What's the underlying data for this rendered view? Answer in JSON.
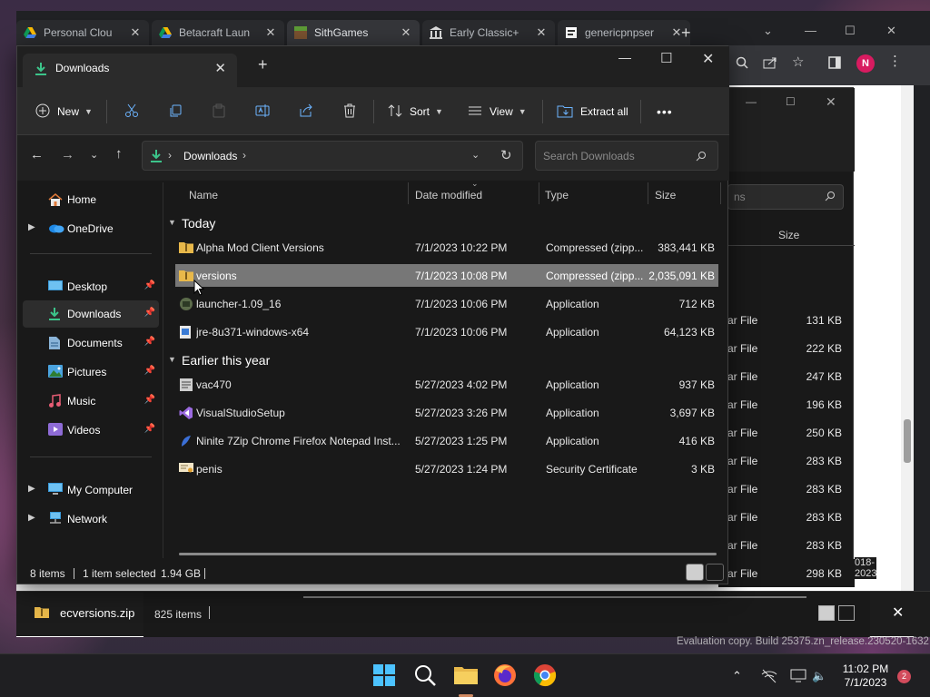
{
  "browser": {
    "tabs": [
      {
        "title": "Personal Clou",
        "icon": "google-drive-icon"
      },
      {
        "title": "Betacraft Laun",
        "icon": "google-drive-icon"
      },
      {
        "title": "SithGames",
        "icon": "minecraft-block-icon"
      },
      {
        "title": "Early Classic+",
        "icon": "bank-icon"
      },
      {
        "title": "genericpnpser",
        "icon": "page-icon"
      }
    ],
    "new_tab": "+",
    "profile_initial": "N"
  },
  "explorer2": {
    "search_placeholder": "ns",
    "size_header": "Size",
    "rows": [
      {
        "type": "ar File",
        "size": "131 KB"
      },
      {
        "type": "ar File",
        "size": "222 KB"
      },
      {
        "type": "ar File",
        "size": "247 KB"
      },
      {
        "type": "ar File",
        "size": "196 KB"
      },
      {
        "type": "ar File",
        "size": "250 KB"
      },
      {
        "type": "ar File",
        "size": "283 KB"
      },
      {
        "type": "ar File",
        "size": "283 KB"
      },
      {
        "type": "ar File",
        "size": "283 KB"
      },
      {
        "type": "ar File",
        "size": "283 KB"
      },
      {
        "type": "ar File",
        "size": "298 KB"
      }
    ],
    "date_fragment": "018-2023",
    "items_count": "825 items",
    "selected_file": "ecversions.zip"
  },
  "explorer": {
    "tab_title": "Downloads",
    "toolbar": {
      "new": "New",
      "sort": "Sort",
      "view": "View",
      "extract_all": "Extract all",
      "more": "•••"
    },
    "address": "Downloads",
    "search_placeholder": "Search Downloads",
    "sidebar": [
      {
        "label": "Home",
        "icon": "home-icon",
        "pinned": false,
        "expandable": false
      },
      {
        "label": "OneDrive",
        "icon": "onedrive-icon",
        "pinned": false,
        "expandable": true
      },
      {
        "label": "Desktop",
        "icon": "desktop-icon",
        "pinned": true,
        "expandable": false
      },
      {
        "label": "Downloads",
        "icon": "downloads-icon",
        "pinned": true,
        "expandable": false,
        "selected": true
      },
      {
        "label": "Documents",
        "icon": "documents-icon",
        "pinned": true,
        "expandable": false
      },
      {
        "label": "Pictures",
        "icon": "pictures-icon",
        "pinned": true,
        "expandable": false
      },
      {
        "label": "Music",
        "icon": "music-icon",
        "pinned": true,
        "expandable": false
      },
      {
        "label": "Videos",
        "icon": "videos-icon",
        "pinned": true,
        "expandable": false
      },
      {
        "label": "My Computer",
        "icon": "computer-icon",
        "pinned": false,
        "expandable": true
      },
      {
        "label": "Network",
        "icon": "network-icon",
        "pinned": false,
        "expandable": true
      }
    ],
    "columns": {
      "name": "Name",
      "date": "Date modified",
      "type": "Type",
      "size": "Size"
    },
    "groups": [
      {
        "label": "Today",
        "files": [
          {
            "name": "Alpha Mod Client Versions",
            "date": "7/1/2023 10:22 PM",
            "type": "Compressed (zipp...",
            "size": "383,441 KB",
            "icon": "zip-folder-icon"
          },
          {
            "name": "versions",
            "date": "7/1/2023 10:08 PM",
            "type": "Compressed (zipp...",
            "size": "2,035,091 KB",
            "icon": "zip-folder-icon",
            "selected": true
          },
          {
            "name": "launcher-1.09_16",
            "date": "7/1/2023 10:06 PM",
            "type": "Application",
            "size": "712 KB",
            "icon": "launcher-app-icon"
          },
          {
            "name": "jre-8u371-windows-x64",
            "date": "7/1/2023 10:06 PM",
            "type": "Application",
            "size": "64,123 KB",
            "icon": "installer-icon"
          }
        ]
      },
      {
        "label": "Earlier this year",
        "files": [
          {
            "name": "vac470",
            "date": "5/27/2023 4:02 PM",
            "type": "Application",
            "size": "937 KB",
            "icon": "app-icon"
          },
          {
            "name": "VisualStudioSetup",
            "date": "5/27/2023 3:26 PM",
            "type": "Application",
            "size": "3,697 KB",
            "icon": "visual-studio-icon"
          },
          {
            "name": "Ninite 7Zip Chrome Firefox Notepad Inst...",
            "date": "5/27/2023 1:25 PM",
            "type": "Application",
            "size": "416 KB",
            "icon": "ninite-icon"
          },
          {
            "name": "penis",
            "date": "5/27/2023 1:24 PM",
            "type": "Security Certificate",
            "size": "3 KB",
            "icon": "certificate-icon"
          }
        ]
      }
    ],
    "status": {
      "items": "8 items",
      "selected": "1 item selected",
      "size": "1.94 GB"
    }
  },
  "taskbar": {
    "time": "11:02 PM",
    "date": "7/1/2023",
    "notifications": "2",
    "watermark": "Evaluation copy. Build 25375.zn_release.230520-1632"
  }
}
